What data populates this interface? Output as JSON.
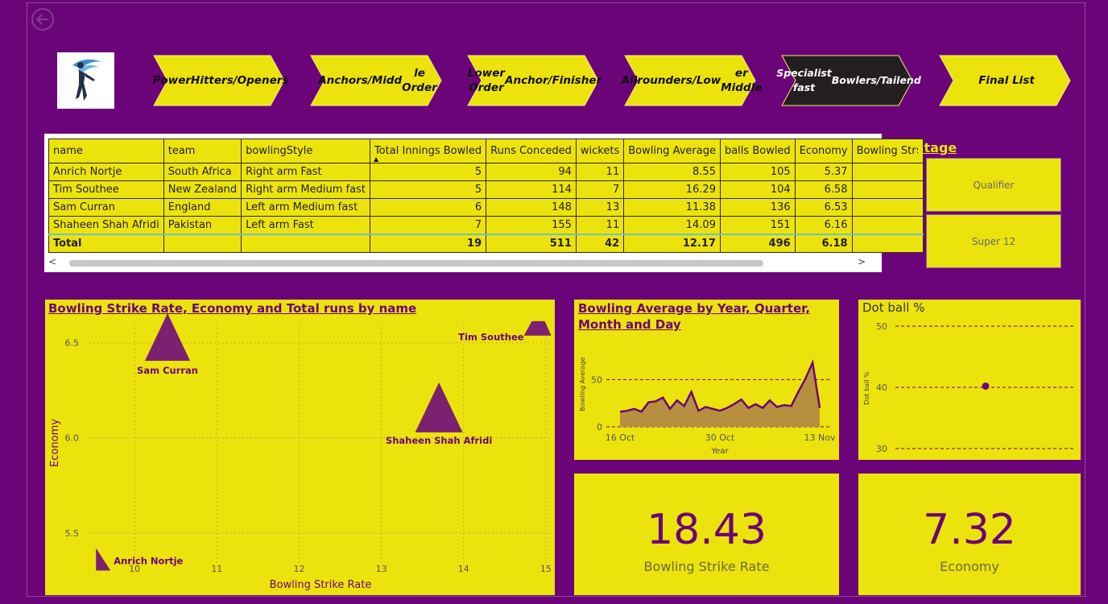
{
  "nav": [
    {
      "label": "Power Hitters/Openers",
      "lines": [
        "Power",
        "Hitters/Opene",
        "rs"
      ],
      "active": false
    },
    {
      "label": "Anchors/Middle Order",
      "lines": [
        "Anchors/Midd",
        "le Order"
      ],
      "active": false
    },
    {
      "label": "Lower Order Anchor/Finisher",
      "lines": [
        "Lower Order",
        "Anchor/Finish",
        "er"
      ],
      "active": false
    },
    {
      "label": "All rounders/Lower Middle",
      "lines": [
        "All",
        "rounders/Low",
        "er Middle"
      ],
      "active": false
    },
    {
      "label": "Specialist fast Bowlers/Tail end",
      "lines": [
        "Specialist fast",
        "Bowlers/Tail",
        "end"
      ],
      "active": true
    },
    {
      "label": "Final List",
      "lines": [
        "Final List"
      ],
      "active": false
    }
  ],
  "table": {
    "columns": [
      "name",
      "team",
      "bowlingStyle",
      "Total Innings Bowled",
      "Runs Conceded",
      "wickets",
      "Bowling Average",
      "balls Bowled",
      "Economy",
      "Bowling Stri"
    ],
    "rows": [
      [
        "Anrich Nortje",
        "South Africa",
        "Right arm Fast",
        "5",
        "94",
        "11",
        "8.55",
        "105",
        "5.37",
        ""
      ],
      [
        "Tim Southee",
        "New Zealand",
        "Right arm Medium fast",
        "5",
        "114",
        "7",
        "16.29",
        "104",
        "6.58",
        ""
      ],
      [
        "Sam Curran",
        "England",
        "Left arm Medium fast",
        "6",
        "148",
        "13",
        "11.38",
        "136",
        "6.53",
        ""
      ],
      [
        "Shaheen Shah Afridi",
        "Pakistan",
        "Left arm Fast",
        "7",
        "155",
        "11",
        "14.09",
        "151",
        "6.16",
        ""
      ]
    ],
    "total": [
      "Total",
      "",
      "",
      "19",
      "511",
      "42",
      "12.17",
      "496",
      "6.18",
      ""
    ],
    "scroll_left": "<",
    "scroll_right": ">"
  },
  "stage": {
    "title": "Stage",
    "options": [
      "Qualifier",
      "Super 12"
    ]
  },
  "kpis": {
    "strike_rate": {
      "value": "18.43",
      "label": "Bowling Strike Rate"
    },
    "economy": {
      "value": "7.32",
      "label": "Economy"
    }
  },
  "colors": {
    "background": "#6b0479",
    "accent": "#ede30c",
    "dark": "#231f20",
    "mark": "#7b2170",
    "area": "#b88f3f"
  },
  "chart_data": [
    {
      "type": "scatter",
      "title": "Bowling Strike Rate, Economy and Total runs by name",
      "xlabel": "Bowling Strike Rate",
      "ylabel": "Economy",
      "xticks": [
        10,
        11,
        12,
        13,
        14,
        15
      ],
      "yticks": [
        5.5,
        6.0,
        6.5
      ],
      "xlim": [
        9.45,
        15.05
      ],
      "ylim": [
        5.33,
        6.6
      ],
      "grid": true,
      "points": [
        {
          "name": "Sam Curran",
          "x": 10.4,
          "y": 6.53,
          "size": 148
        },
        {
          "name": "Tim Southee",
          "x": 14.85,
          "y": 6.58,
          "size": 114
        },
        {
          "name": "Shaheen Shah Afridi",
          "x": 13.7,
          "y": 6.16,
          "size": 155
        },
        {
          "name": "Anrich Nortje",
          "x": 9.55,
          "y": 5.37,
          "size": 94
        }
      ]
    },
    {
      "type": "area",
      "title": "Bowling Average by Year, Quarter, Month and Day",
      "xlabel": "Year",
      "ylabel": "Bowling Average",
      "xticks": [
        "16 Oct",
        "30 Oct",
        "13 Nov"
      ],
      "yticks": [
        0,
        50
      ],
      "ylim": [
        0,
        75
      ],
      "x": [
        "16 Oct",
        "17 Oct",
        "18 Oct",
        "19 Oct",
        "20 Oct",
        "21 Oct",
        "22 Oct",
        "23 Oct",
        "24 Oct",
        "25 Oct",
        "26 Oct",
        "27 Oct",
        "28 Oct",
        "29 Oct",
        "30 Oct",
        "31 Oct",
        "1 Nov",
        "2 Nov",
        "3 Nov",
        "4 Nov",
        "5 Nov",
        "6 Nov",
        "7 Nov",
        "8 Nov",
        "9 Nov",
        "10 Nov",
        "11 Nov",
        "12 Nov",
        "13 Nov"
      ],
      "values": [
        16,
        17,
        19,
        16,
        26,
        27,
        31,
        19,
        28,
        22,
        37,
        17,
        21,
        19,
        17,
        20,
        24,
        29,
        20,
        24,
        20,
        28,
        21,
        23,
        22,
        37,
        51,
        68,
        20
      ]
    },
    {
      "type": "scatter",
      "title": "Dot ball %",
      "ylabel": "Dot ball %",
      "yticks": [
        30,
        40,
        50
      ],
      "ylim": [
        30,
        50
      ],
      "points": [
        {
          "y": 40.2
        }
      ]
    }
  ]
}
